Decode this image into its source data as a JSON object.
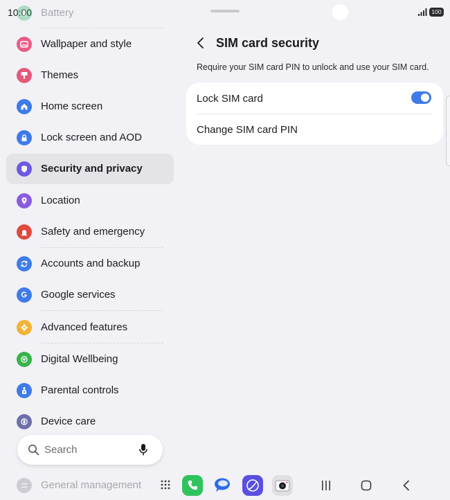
{
  "status_bar": {
    "time": "10:00",
    "battery_level": "100",
    "signal_icon": "signal-icon"
  },
  "left_pane": {
    "faded_top_item": {
      "label": "Battery",
      "icon": "battery-icon",
      "color": "#2fb36a"
    },
    "items": [
      {
        "label": "Wallpaper and style",
        "icon": "wallpaper-icon",
        "color": "#ea5b85",
        "selected": false
      },
      {
        "label": "Themes",
        "icon": "themes-icon",
        "color": "#e5597b",
        "selected": false
      },
      {
        "label": "Home screen",
        "icon": "home-icon",
        "color": "#3e7be8",
        "selected": false
      },
      {
        "label": "Lock screen and AOD",
        "icon": "lock-icon",
        "color": "#3e7be8",
        "selected": false
      },
      {
        "label": "Security and privacy",
        "icon": "shield-icon",
        "color": "#6b5be3",
        "selected": true
      },
      {
        "label": "Location",
        "icon": "location-icon",
        "color": "#8a5ce0",
        "selected": false
      },
      {
        "label": "Safety and emergency",
        "icon": "emergency-icon",
        "color": "#df4a3f",
        "selected": false
      },
      {
        "label": "Accounts and backup",
        "icon": "sync-icon",
        "color": "#3e7be8",
        "selected": false
      },
      {
        "label": "Google services",
        "icon": "google-icon",
        "color": "#3e7be8",
        "selected": false
      },
      {
        "label": "Advanced features",
        "icon": "gear-star-icon",
        "color": "#f2b236",
        "selected": false
      },
      {
        "label": "Digital Wellbeing",
        "icon": "wellbeing-icon",
        "color": "#38b24a",
        "selected": false
      },
      {
        "label": "Parental controls",
        "icon": "parental-icon",
        "color": "#3e7be8",
        "selected": false
      },
      {
        "label": "Device care",
        "icon": "device-care-icon",
        "color": "#6e6fa8",
        "selected": false
      }
    ],
    "faded_bottom_item": {
      "label": "General management",
      "icon": "management-icon",
      "color": "#8a8a90"
    },
    "search": {
      "placeholder": "Search"
    }
  },
  "detail": {
    "title": "SIM card security",
    "description": "Require your SIM card PIN to unlock and use your SIM card.",
    "lock_sim_label": "Lock SIM card",
    "lock_sim_enabled": true,
    "change_pin_label": "Change SIM card PIN"
  },
  "dock": {
    "apps": [
      {
        "name": "phone-app-icon",
        "color": "#2fc35e"
      },
      {
        "name": "messages-app-icon",
        "color": "#ffffff"
      },
      {
        "name": "internet-app-icon",
        "color": "#5a4fe0"
      },
      {
        "name": "camera-app-icon",
        "color": "#e0e0e4"
      }
    ]
  }
}
